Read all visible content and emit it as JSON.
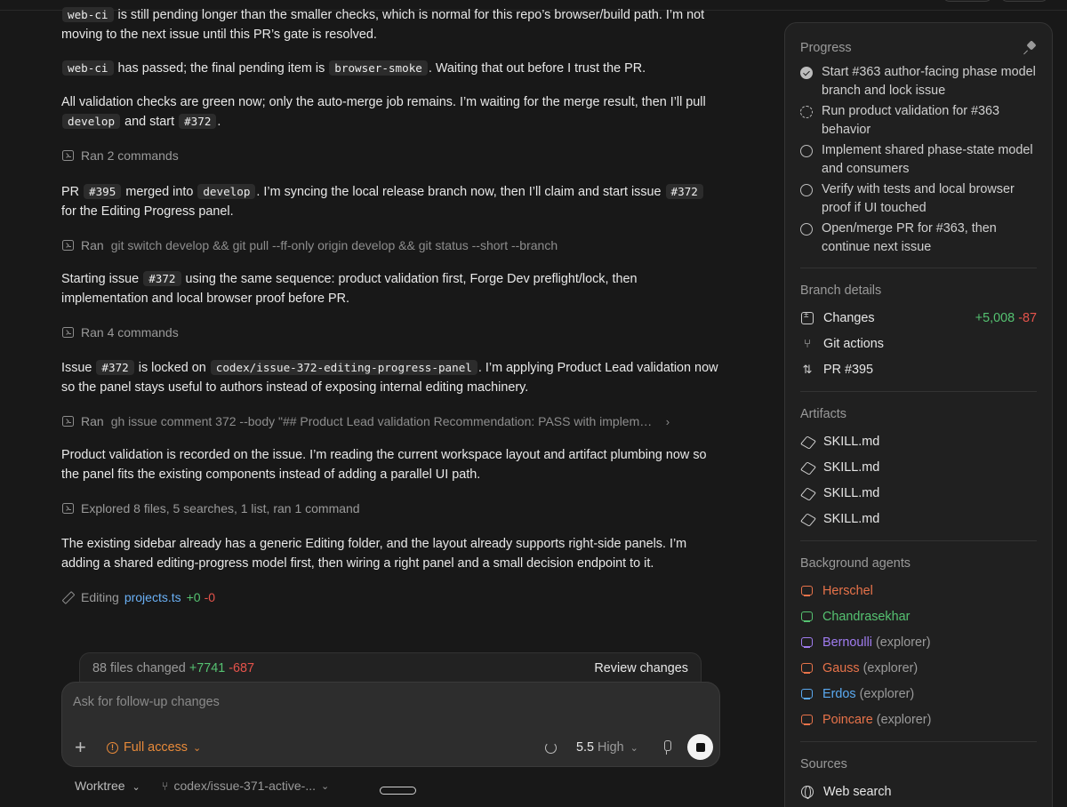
{
  "chat": {
    "p1": {
      "code": "web-ci",
      "text": "is still pending longer than the smaller checks, which is normal for this repo’s browser/build path. I’m not moving to the next issue until this PR’s gate is resolved."
    },
    "p2": {
      "code1": "web-ci",
      "text1": "has passed; the final pending item is",
      "code2": "browser-smoke",
      "text2": ". Waiting that out before I trust the PR."
    },
    "p3": {
      "text1": "All validation checks are green now; only the auto-merge job remains. I’m waiting for the merge result, then I’ll pull",
      "code1": "develop",
      "text2": "and start",
      "code2": "#372",
      "text3": "."
    },
    "c1": {
      "label": "Ran 2 commands"
    },
    "p4": {
      "text1": "PR",
      "code1": "#395",
      "text2": "merged into",
      "code2": "develop",
      "text3": ". I’m syncing the local release branch now, then I’ll claim and start issue",
      "code3": "#372",
      "text4": "for the Editing Progress panel."
    },
    "c2": {
      "label": "Ran",
      "command": "git switch develop && git pull --ff-only origin develop && git status --short --branch"
    },
    "p5": {
      "text1": "Starting issue",
      "code1": "#372",
      "text2": "using the same sequence: product validation first, Forge Dev preflight/lock, then implementation and local browser proof before PR."
    },
    "c3": {
      "label": "Ran 4 commands"
    },
    "p6": {
      "text1": "Issue",
      "code1": "#372",
      "text2": "is locked on",
      "code2": "codex/issue-372-editing-progress-panel",
      "text3": ". I’m applying Product Lead validation now so the panel stays useful to authors instead of exposing internal editing machinery."
    },
    "c4": {
      "label": "Ran",
      "command": "gh issue comment 372 --body \"## Product Lead validation Recommendation: PASS with implementa..."
    },
    "p7": {
      "text": "Product validation is recorded on the issue. I’m reading the current workspace layout and artifact plumbing now so the panel fits the existing components instead of adding a parallel UI path."
    },
    "c5": {
      "label": "Explored 8 files, 5 searches, 1 list, ran 1 command"
    },
    "p8": {
      "text": "The existing sidebar already has a generic Editing folder, and the layout already supports right-side panels. I’m adding a shared editing-progress model first, then wiring a right panel and a small decision endpoint to it."
    },
    "edit": {
      "label": "Editing",
      "file": "projects.ts",
      "added": "+0",
      "removed": "-0"
    }
  },
  "files_bar": {
    "count_label": "88 files changed",
    "added": "+7741",
    "removed": "-687",
    "review_label": "Review changes"
  },
  "composer": {
    "placeholder": "Ask for follow-up changes",
    "access_label": "Full access",
    "model": "5.5",
    "effort": "High"
  },
  "footer": {
    "worktree_label": "Worktree",
    "branch": "codex/issue-371-active-..."
  },
  "panel": {
    "progress_title": "Progress",
    "steps": [
      {
        "label": "Start #363 author-facing phase model branch and lock issue",
        "state": "done"
      },
      {
        "label": "Run product validation for #363 behavior",
        "state": "active"
      },
      {
        "label": "Implement shared phase-state model and consumers",
        "state": "pending"
      },
      {
        "label": "Verify with tests and local browser proof if UI touched",
        "state": "pending"
      },
      {
        "label": "Open/merge PR for #363, then continue next issue",
        "state": "pending"
      }
    ],
    "branch_title": "Branch details",
    "changes_label": "Changes",
    "changes_added": "+5,008",
    "changes_removed": "-87",
    "git_actions_label": "Git actions",
    "pr_label": "PR #395",
    "artifacts_title": "Artifacts",
    "artifacts": [
      "SKILL.md",
      "SKILL.md",
      "SKILL.md",
      "SKILL.md"
    ],
    "agents_title": "Background agents",
    "agents": [
      {
        "name": "Herschel",
        "role": "",
        "color": "#e8734a"
      },
      {
        "name": "Chandrasekhar",
        "role": "",
        "color": "#55c271"
      },
      {
        "name": "Bernoulli",
        "role": "(explorer)",
        "color": "#a07cf0"
      },
      {
        "name": "Gauss",
        "role": "(explorer)",
        "color": "#e8734a"
      },
      {
        "name": "Erdos",
        "role": "(explorer)",
        "color": "#5aa9f0"
      },
      {
        "name": "Poincare",
        "role": "(explorer)",
        "color": "#e8734a"
      }
    ],
    "sources_title": "Sources",
    "source_web": "Web search"
  }
}
